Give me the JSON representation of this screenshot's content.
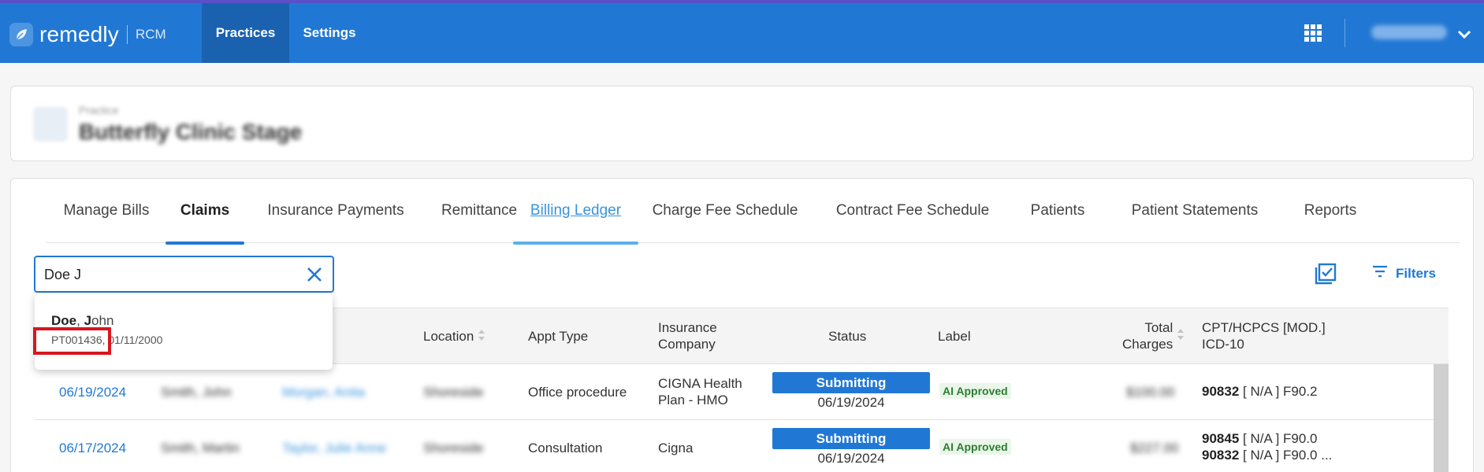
{
  "app": {
    "brand": "remedly",
    "brand_sub": "RCM",
    "nav": [
      {
        "label": "Practices",
        "active": true
      },
      {
        "label": "Settings",
        "active": false
      }
    ],
    "user_name": "Nolan Ops"
  },
  "practice": {
    "label": "Practice",
    "name": "Butterfly Clinic Stage"
  },
  "tabs": [
    {
      "label": "Manage Bills"
    },
    {
      "label": "Claims",
      "active": true
    },
    {
      "label": "Insurance Payments"
    },
    {
      "label": "Remittance"
    },
    {
      "label": "Billing Ledger",
      "linked": true
    },
    {
      "label": "Charge Fee Schedule"
    },
    {
      "label": "Contract Fee Schedule"
    },
    {
      "label": "Patients"
    },
    {
      "label": "Patient Statements"
    },
    {
      "label": "Reports"
    }
  ],
  "search": {
    "value": "Doe J"
  },
  "toolbar": {
    "filters_label": "Filters"
  },
  "autocomplete": {
    "name_bold": "Doe",
    "name_sep": ", ",
    "name_match": "J",
    "name_rest": "ohn",
    "patient_id": "PT001436",
    "dob": "01/11/2000"
  },
  "table": {
    "headers": {
      "location": "Location",
      "appt_type": "Appt Type",
      "insurance_line1": "Insurance",
      "insurance_line2": "Company",
      "status": "Status",
      "label": "Label",
      "total_line1": "Total",
      "total_line2": "Charges",
      "cpt_line1": "CPT/HCPCS [MOD.]",
      "cpt_line2": "ICD-10"
    },
    "rows": [
      {
        "date": "06/19/2024",
        "patient": "Smith, John",
        "provider": "Morgan, Anita",
        "location": "Shoreside",
        "appt_type": "Office procedure",
        "insurance_line1": "CIGNA Health",
        "insurance_line2": "Plan - HMO",
        "status": "Submitting",
        "status_date": "06/19/2024",
        "label": "AI Approved",
        "total": "$100.00",
        "cpt": [
          {
            "code": "90832",
            "rest": " [ N/A ] F90.2"
          }
        ]
      },
      {
        "date": "06/17/2024",
        "patient": "Smith, Martin",
        "provider": "Taylor, Julie Anne",
        "location": "Shoreside",
        "appt_type": "Consultation",
        "insurance_line1": "Cigna",
        "insurance_line2": "",
        "status": "Submitting",
        "status_date": "06/19/2024",
        "label": "AI Approved",
        "total": "$227.00",
        "cpt": [
          {
            "code": "90845",
            "rest": " [ N/A ] F90.0"
          },
          {
            "code": "90832",
            "rest": " [ N/A ] F90.0 ..."
          }
        ]
      }
    ]
  },
  "colors": {
    "brand_blue": "#2178d4",
    "nav_active": "#1a62b0",
    "highlight_red": "#d8161e",
    "approved_green": "#2e7d32"
  },
  "icons": {
    "brand_logo": "leaf-icon",
    "apps": "grid-icon",
    "user_menu": "chevron-down-icon",
    "search_clear": "close-icon",
    "select_all": "checklist-icon",
    "filters": "filter-lines-icon",
    "sort": "sort-icon"
  }
}
